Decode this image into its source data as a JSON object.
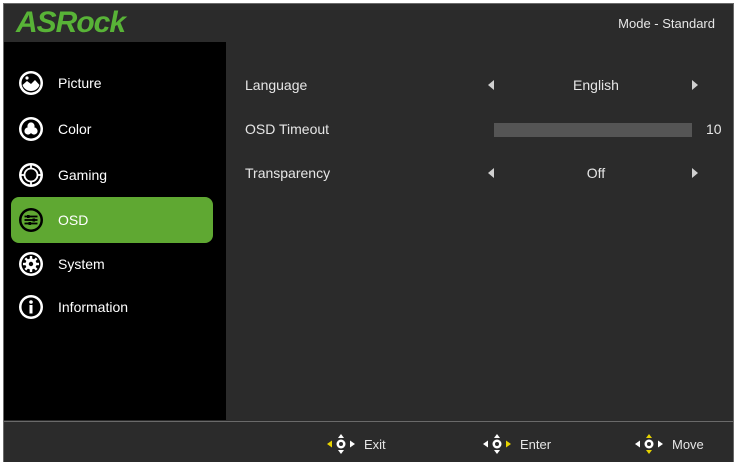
{
  "header": {
    "logo_text": "ASRock",
    "mode_text": "Mode - Standard"
  },
  "sidebar": {
    "items": [
      {
        "label": "Picture",
        "icon": "picture-icon"
      },
      {
        "label": "Color",
        "icon": "color-icon"
      },
      {
        "label": "Gaming",
        "icon": "gaming-icon"
      },
      {
        "label": "OSD",
        "icon": "osd-icon",
        "active": true
      },
      {
        "label": "System",
        "icon": "system-icon"
      },
      {
        "label": "Information",
        "icon": "information-icon"
      }
    ]
  },
  "main": {
    "language": {
      "label": "Language",
      "value": "English"
    },
    "osd_timeout": {
      "label": "OSD Timeout",
      "value": "10"
    },
    "transparency": {
      "label": "Transparency",
      "value": "Off"
    }
  },
  "footer": {
    "exit_label": "Exit",
    "enter_label": "Enter",
    "move_label": "Move"
  },
  "colors": {
    "accent": "#5fa832",
    "background": "#2b2b2b",
    "sidebar": "#000000",
    "joystick": "#e8d400"
  }
}
